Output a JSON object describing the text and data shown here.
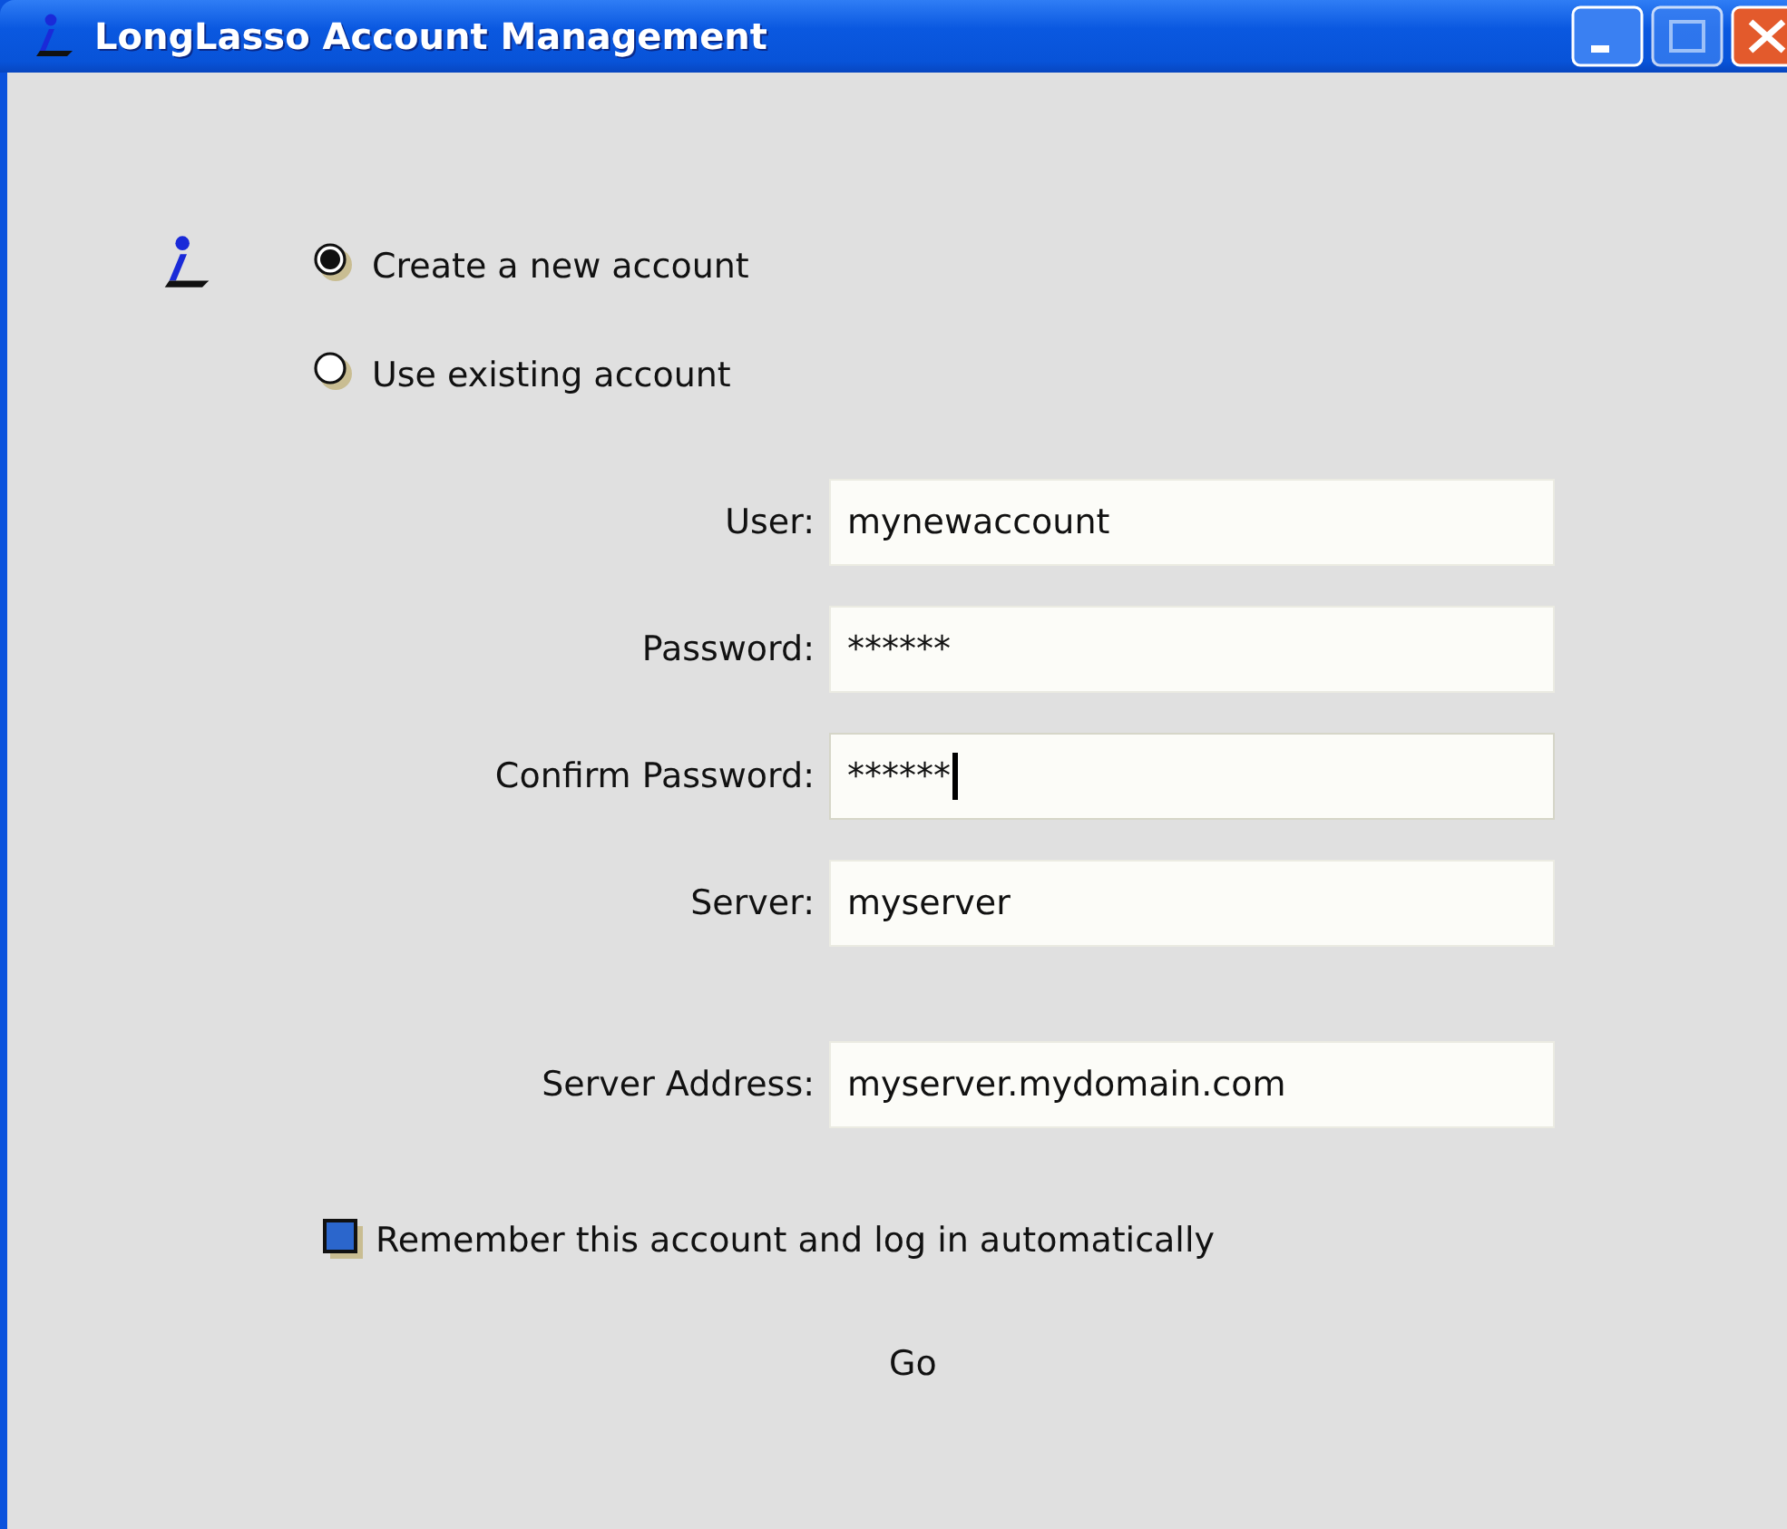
{
  "window": {
    "title": "LongLasso Account Management"
  },
  "account_options": [
    {
      "label": "Create a new account",
      "selected": true
    },
    {
      "label": "Use existing account",
      "selected": false
    }
  ],
  "account_fields": [
    {
      "label": "User:",
      "value": "mynewaccount",
      "focused": false
    },
    {
      "label": "Password:",
      "value": "******",
      "focused": false
    },
    {
      "label": "Confirm Password:",
      "value": "******",
      "focused": true
    },
    {
      "label": "Server:",
      "value": "myserver",
      "focused": false
    }
  ],
  "address_fields": [
    {
      "label": "Server Address:",
      "value": "myserver.mydomain.com",
      "focused": false
    }
  ],
  "remember": {
    "label": "Remember this account and log in automatically",
    "checked": true
  },
  "go_button": {
    "label": "Go"
  }
}
